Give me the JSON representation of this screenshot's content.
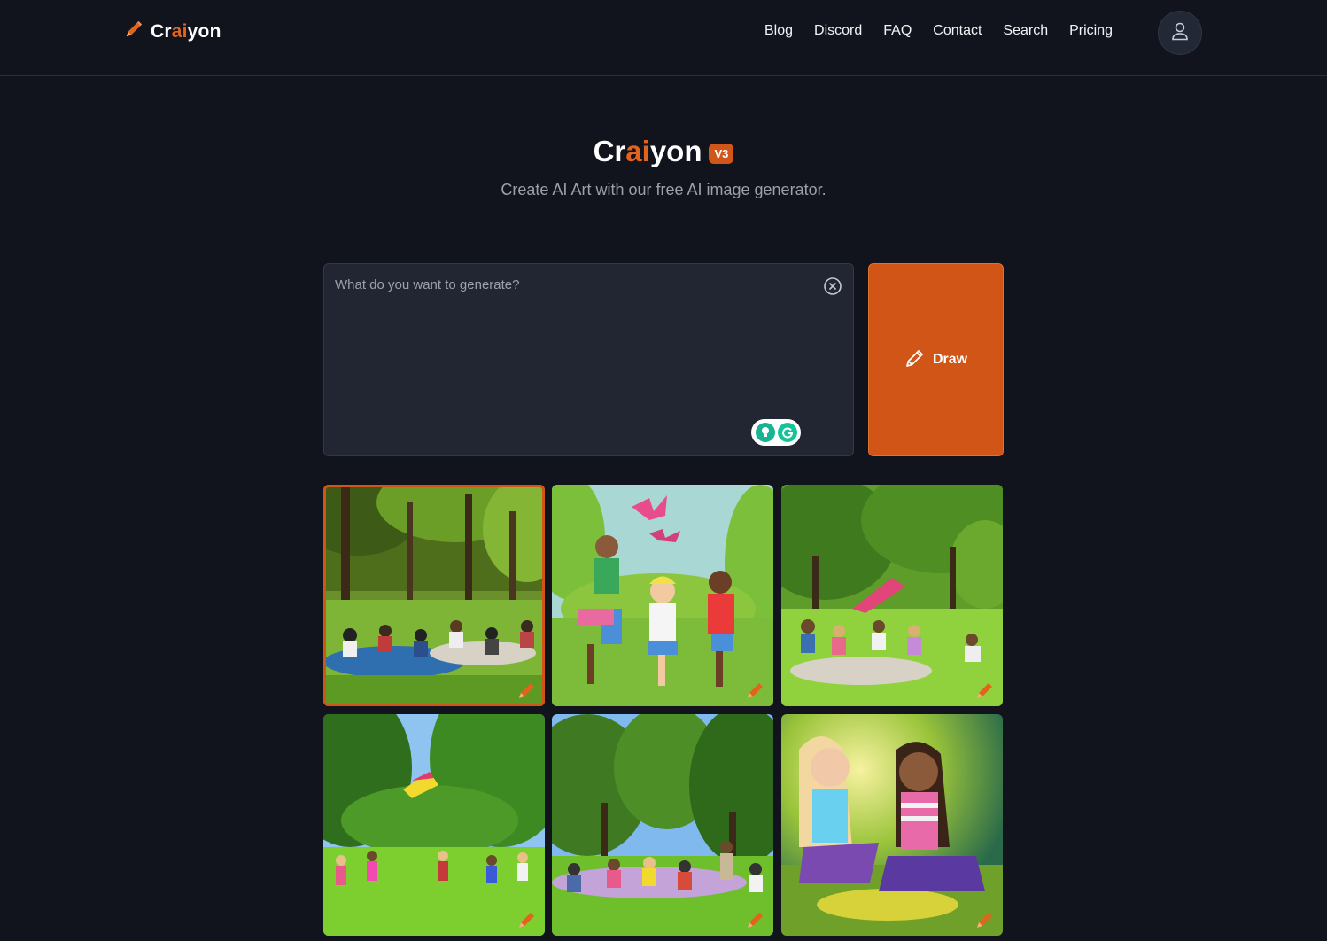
{
  "brand": {
    "prefix": "Cr",
    "ai": "ai",
    "suffix": "yon"
  },
  "nav": {
    "items": [
      {
        "label": "Blog"
      },
      {
        "label": "Discord"
      },
      {
        "label": "FAQ"
      },
      {
        "label": "Contact"
      },
      {
        "label": "Search"
      },
      {
        "label": "Pricing"
      }
    ]
  },
  "icons": {
    "logo": "pencil-icon",
    "account": "user-icon",
    "clear": "close-circle-icon",
    "draw": "pencil-icon",
    "grammarly": "grammarly-icon"
  },
  "hero": {
    "version_badge": "V3",
    "subtitle": "Create AI Art with our free AI image generator."
  },
  "prompt": {
    "placeholder": "What do you want to generate?",
    "value": ""
  },
  "draw_button": {
    "label": "Draw"
  },
  "colors": {
    "accent": "#d15516",
    "background": "#11141c",
    "panel": "#222633"
  },
  "gallery": {
    "images": [
      {
        "scene": "picnic-in-forest",
        "selected": true
      },
      {
        "scene": "cartoon-kids-butterflies",
        "selected": false
      },
      {
        "scene": "park-picnic-with-kite",
        "selected": false
      },
      {
        "scene": "kids-running-with-kite",
        "selected": false
      },
      {
        "scene": "crowded-park-picnic",
        "selected": false
      },
      {
        "scene": "two-girls-laughing",
        "selected": false
      }
    ]
  }
}
